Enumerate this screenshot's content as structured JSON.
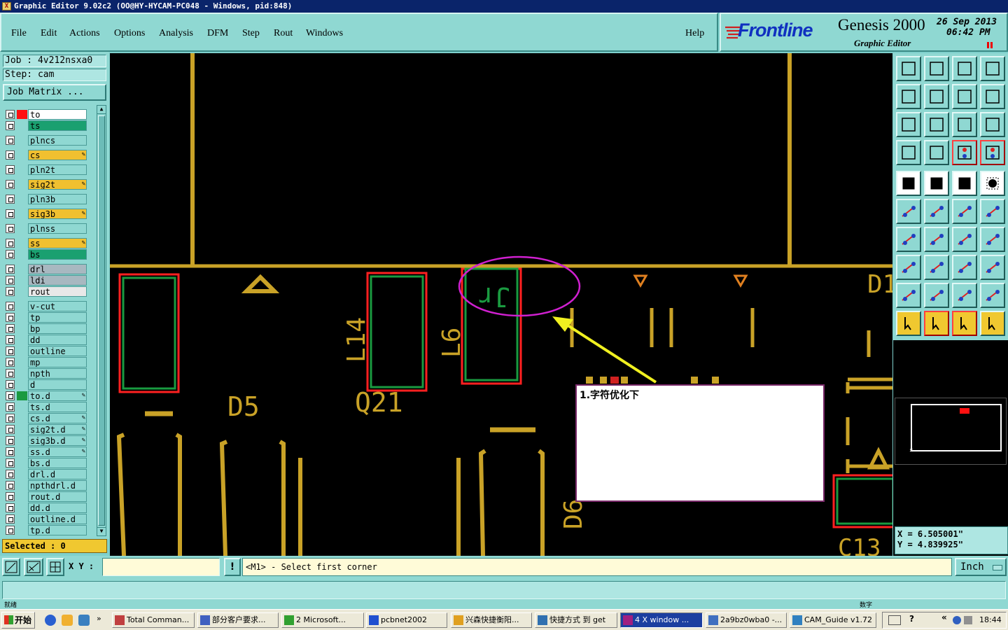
{
  "window": {
    "title": "Graphic Editor 9.02c2  (OO@HY-HYCAM-PC048 - Windows, pid:848)"
  },
  "menu": [
    "File",
    "Edit",
    "Actions",
    "Options",
    "Analysis",
    "DFM",
    "Step",
    "Rout",
    "Windows"
  ],
  "help": "Help",
  "logo": {
    "brand": "Frontline",
    "product": "Genesis 2000",
    "subtitle": "Graphic Editor",
    "date": "26  Sep  2013",
    "time": "06:42  PM"
  },
  "job": {
    "job_label": "Job  :  4v212nsxa0",
    "step_label": "Step:  cam",
    "matrix_button": "Job Matrix ..."
  },
  "layers": [
    {
      "name": "to",
      "color": "#ffffff",
      "active": true
    },
    {
      "name": "ts",
      "color": "#1aa070"
    },
    {
      "name": "plncs",
      "color": "#8fd8d2"
    },
    {
      "name": "cs",
      "color": "#f0c030",
      "pen": true
    },
    {
      "name": "pln2t",
      "color": "#8fd8d2"
    },
    {
      "name": "sig2t",
      "color": "#f0c030",
      "pen": true
    },
    {
      "name": "pln3b",
      "color": "#8fd8d2"
    },
    {
      "name": "sig3b",
      "color": "#f0c030",
      "pen": true
    },
    {
      "name": "plnss",
      "color": "#8fd8d2"
    },
    {
      "name": "ss",
      "color": "#f0c030",
      "pen": true
    },
    {
      "name": "bs",
      "color": "#1aa070"
    },
    {
      "name": "drl",
      "color": "#a8b8c0"
    },
    {
      "name": "ldi",
      "color": "#a8b8c0"
    },
    {
      "name": "rout",
      "color": "#e8e8e8"
    },
    {
      "name": "v-cut",
      "color": "#8fd8d2"
    },
    {
      "name": "tp",
      "color": "#8fd8d2"
    },
    {
      "name": "bp",
      "color": "#8fd8d2"
    },
    {
      "name": "dd",
      "color": "#8fd8d2"
    },
    {
      "name": "outline",
      "color": "#8fd8d2"
    },
    {
      "name": "mp",
      "color": "#8fd8d2"
    },
    {
      "name": "npth",
      "color": "#8fd8d2"
    },
    {
      "name": "d",
      "color": "#8fd8d2"
    },
    {
      "name": "to.d",
      "color": "#8fd8d2",
      "pen": true,
      "aff": true
    },
    {
      "name": "ts.d",
      "color": "#8fd8d2"
    },
    {
      "name": "cs.d",
      "color": "#8fd8d2",
      "pen": true
    },
    {
      "name": "sig2t.d",
      "color": "#8fd8d2",
      "pen": true
    },
    {
      "name": "sig3b.d",
      "color": "#8fd8d2",
      "pen": true
    },
    {
      "name": "ss.d",
      "color": "#8fd8d2",
      "pen": true
    },
    {
      "name": "bs.d",
      "color": "#8fd8d2"
    },
    {
      "name": "drl.d",
      "color": "#8fd8d2"
    },
    {
      "name": "npthdrl.d",
      "color": "#8fd8d2"
    },
    {
      "name": "rout.d",
      "color": "#8fd8d2"
    },
    {
      "name": "dd.d",
      "color": "#8fd8d2"
    },
    {
      "name": "outline.d",
      "color": "#8fd8d2"
    },
    {
      "name": "tp.d",
      "color": "#8fd8d2"
    }
  ],
  "selected": "Selected : 0",
  "canvas_labels": {
    "d5": "D5",
    "q21": "Q21",
    "l14": "L14",
    "l6": "L6",
    "d6": "D6",
    "c13": "C13",
    "d1": "D1",
    "rotated_text": "Jr"
  },
  "callout": {
    "text": "1.字符优化下"
  },
  "coords": {
    "x": "X  =  6.505001\"",
    "y": "Y  =  4.839925\""
  },
  "command": {
    "xy_label": "X Y :",
    "message": "<M1> - Select first corner",
    "units": "Inch"
  },
  "status": {
    "left_tiny": "就绪",
    "right_tiny": "数字"
  },
  "taskbar": {
    "start": "开始",
    "tasks": [
      "Total Comman...",
      "部分客户要求...",
      "2 Microsoft...",
      "pcbnet2002",
      "兴森快捷衡阳...",
      "快捷方式 到 get",
      "4 X window ...",
      "2a9bz0wba0 -...",
      "CAM_Guide v1.72"
    ],
    "clock": "18:44"
  }
}
